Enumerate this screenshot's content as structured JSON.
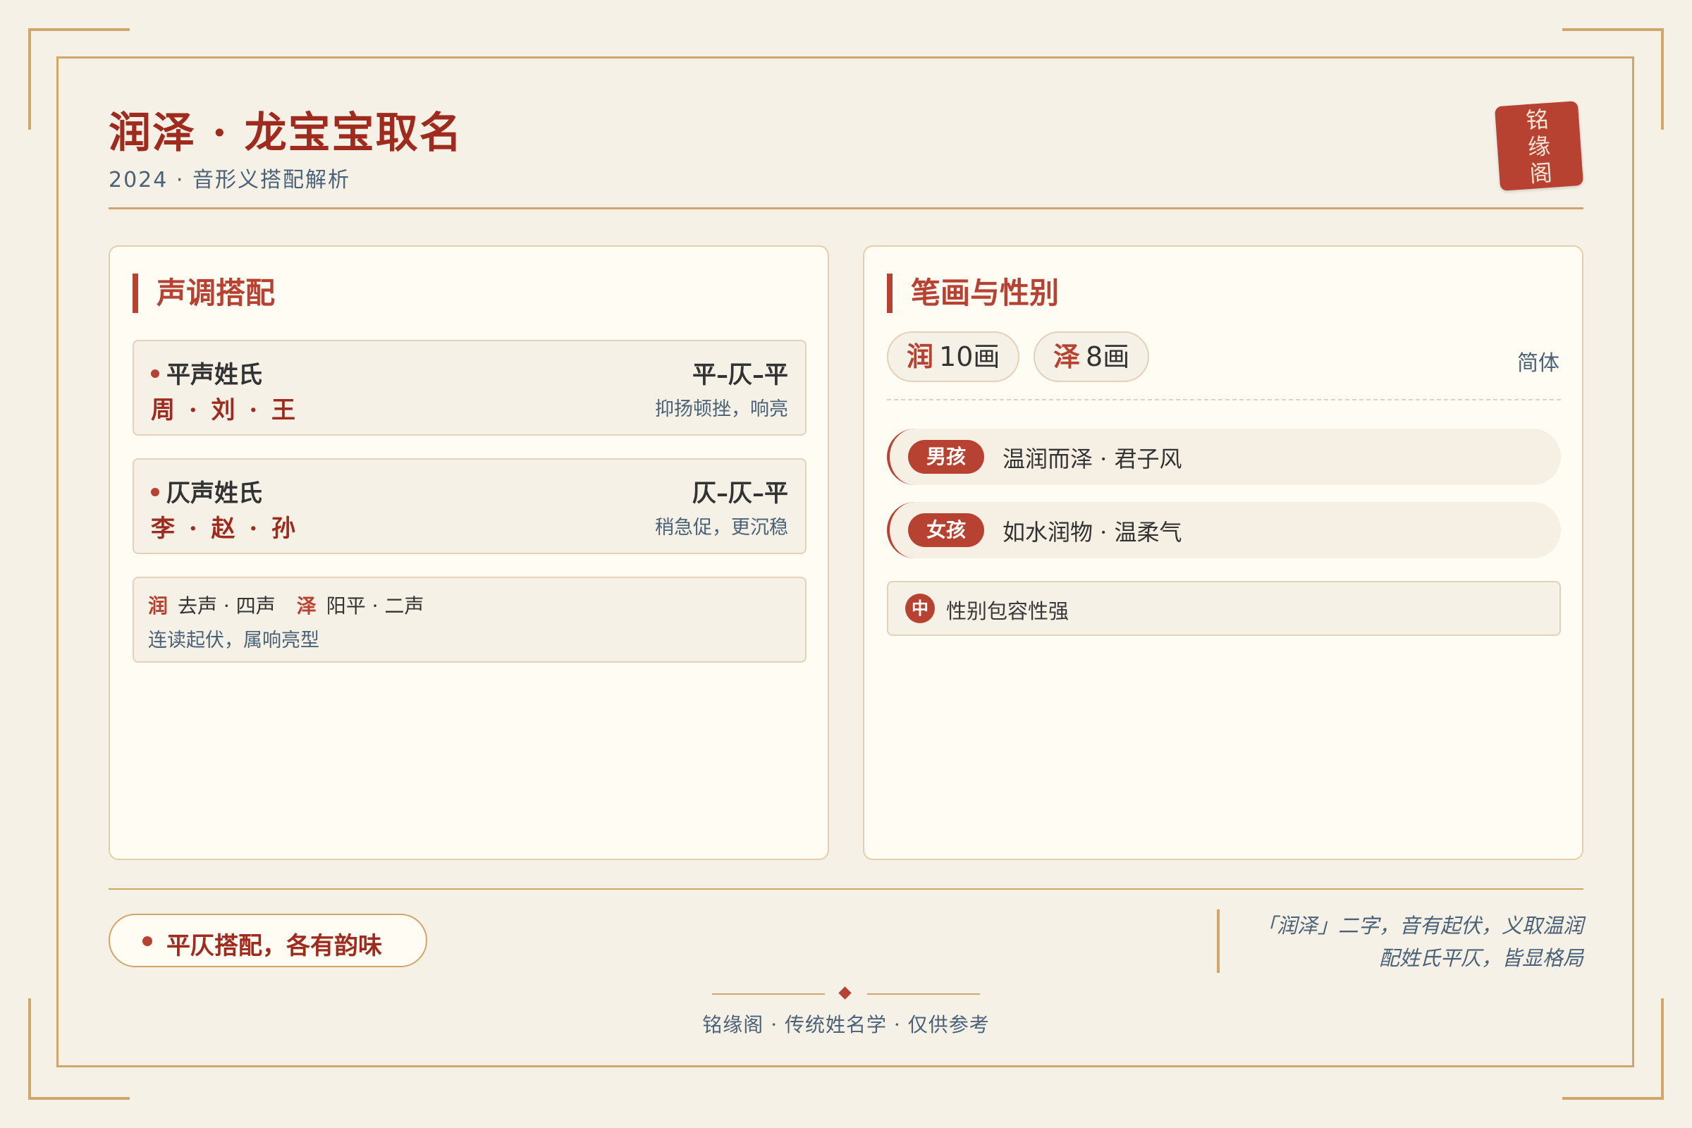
{
  "header": {
    "title": "润泽 · 龙宝宝取名",
    "subtitle": "2024 · 音形义搭配解析",
    "seal_chars": [
      "铭",
      "缘",
      "阁"
    ]
  },
  "tone_card": {
    "title": "声调搭配",
    "groups": [
      {
        "label": "平声姓氏",
        "names": "周 · 刘 · 王",
        "pattern": "平–仄–平",
        "note": "抑扬顿挫，响亮"
      },
      {
        "label": "仄声姓氏",
        "names": "李 · 赵 · 孙",
        "pattern": "仄–仄–平",
        "note": "稍急促，更沉稳"
      }
    ],
    "info": {
      "char1": "润",
      "char1_tone": "去声 · 四声",
      "char2": "泽",
      "char2_tone": "阳平 · 二声",
      "summary": "连读起伏，属响亮型"
    }
  },
  "stroke_card": {
    "title": "笔画与性别",
    "strokes": [
      {
        "char": "润",
        "count": "10画"
      },
      {
        "char": "泽",
        "count": "8画"
      }
    ],
    "script_note": "简体",
    "genders": [
      {
        "tag": "男孩",
        "text": "温润而泽 · 君子风"
      },
      {
        "tag": "女孩",
        "text": "如水润物 · 温柔气"
      }
    ],
    "neutral": {
      "icon": "中",
      "text": "性别包容性强"
    }
  },
  "summary_pill": "平仄搭配，各有韵味",
  "quote": [
    "「润泽」二字，音有起伏，义取温润",
    "配姓氏平仄，皆显格局"
  ],
  "footer": "铭缘阁 · 传统姓名学 · 仅供参考",
  "colors": {
    "accent": "#b84232",
    "gold": "#d2a56a",
    "background": "#f6f1e7",
    "muted": "#4a6278"
  }
}
